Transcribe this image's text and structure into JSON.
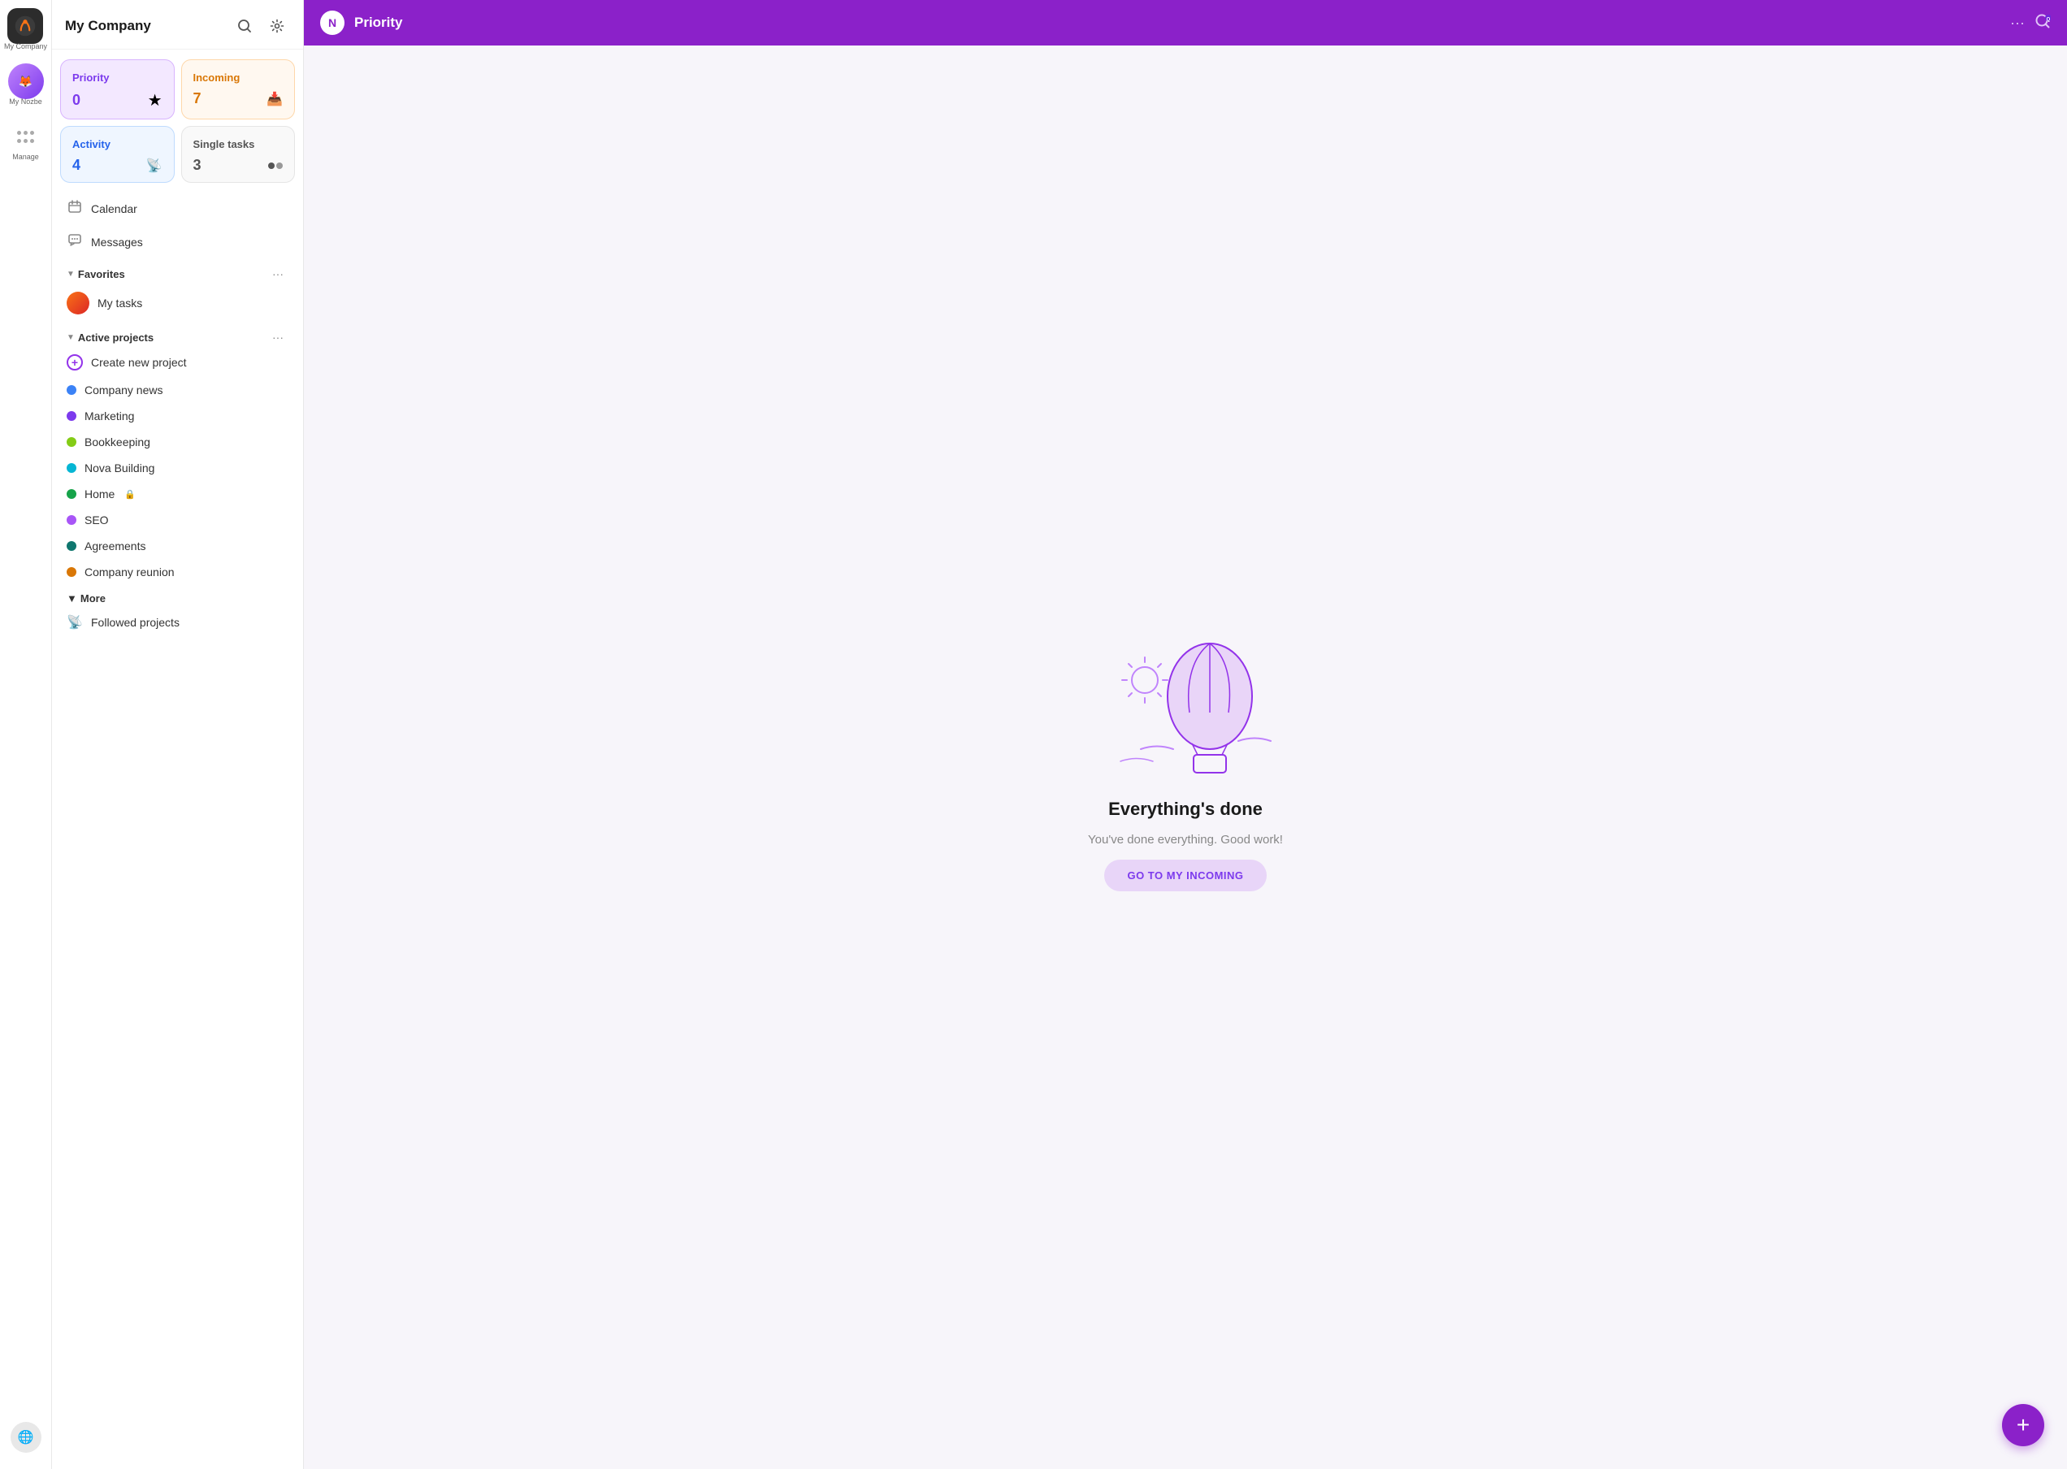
{
  "app": {
    "name": "My Company",
    "icon_initials": "N"
  },
  "icon_column": {
    "app_label": "My Company",
    "user_label": "My Nozbe",
    "manage_label": "Manage"
  },
  "header": {
    "search_title": "Search",
    "settings_title": "Settings"
  },
  "tiles": [
    {
      "id": "priority",
      "label": "Priority",
      "count": "0",
      "icon": "★",
      "type": "priority"
    },
    {
      "id": "incoming",
      "label": "Incoming",
      "count": "7",
      "icon": "📥",
      "type": "incoming"
    },
    {
      "id": "activity",
      "label": "Activity",
      "count": "4",
      "icon": "📡",
      "type": "activity"
    },
    {
      "id": "single",
      "label": "Single tasks",
      "count": "3",
      "icon": "⚫",
      "type": "single"
    }
  ],
  "nav": {
    "calendar_label": "Calendar",
    "messages_label": "Messages"
  },
  "favorites": {
    "section_label": "Favorites",
    "my_tasks_label": "My tasks",
    "more_dots": "···"
  },
  "active_projects": {
    "section_label": "Active projects",
    "more_dots": "···",
    "create_label": "Create new project",
    "items": [
      {
        "name": "Company news",
        "color": "#3b82f6"
      },
      {
        "name": "Marketing",
        "color": "#7c3aed"
      },
      {
        "name": "Bookkeeping",
        "color": "#84cc16"
      },
      {
        "name": "Nova Building",
        "color": "#06b6d4"
      },
      {
        "name": "Home",
        "color": "#16a34a",
        "locked": true
      },
      {
        "name": "SEO",
        "color": "#a855f7"
      },
      {
        "name": "Agreements",
        "color": "#0f766e"
      },
      {
        "name": "Company reunion",
        "color": "#d97706"
      }
    ]
  },
  "more_section": {
    "section_label": "More",
    "followed_label": "Followed projects"
  },
  "topbar": {
    "logo_text": "N",
    "title": "Priority",
    "dots": "···"
  },
  "empty_state": {
    "title": "Everything's done",
    "subtitle": "You've done everything. Good work!",
    "button_label": "GO TO MY INCOMING"
  },
  "fab": {
    "label": "+"
  },
  "colors": {
    "priority_purple": "#8b21c9",
    "tile_priority_bg": "#f3e8ff",
    "tile_incoming_bg": "#fff8f0",
    "tile_activity_bg": "#eff6ff"
  }
}
